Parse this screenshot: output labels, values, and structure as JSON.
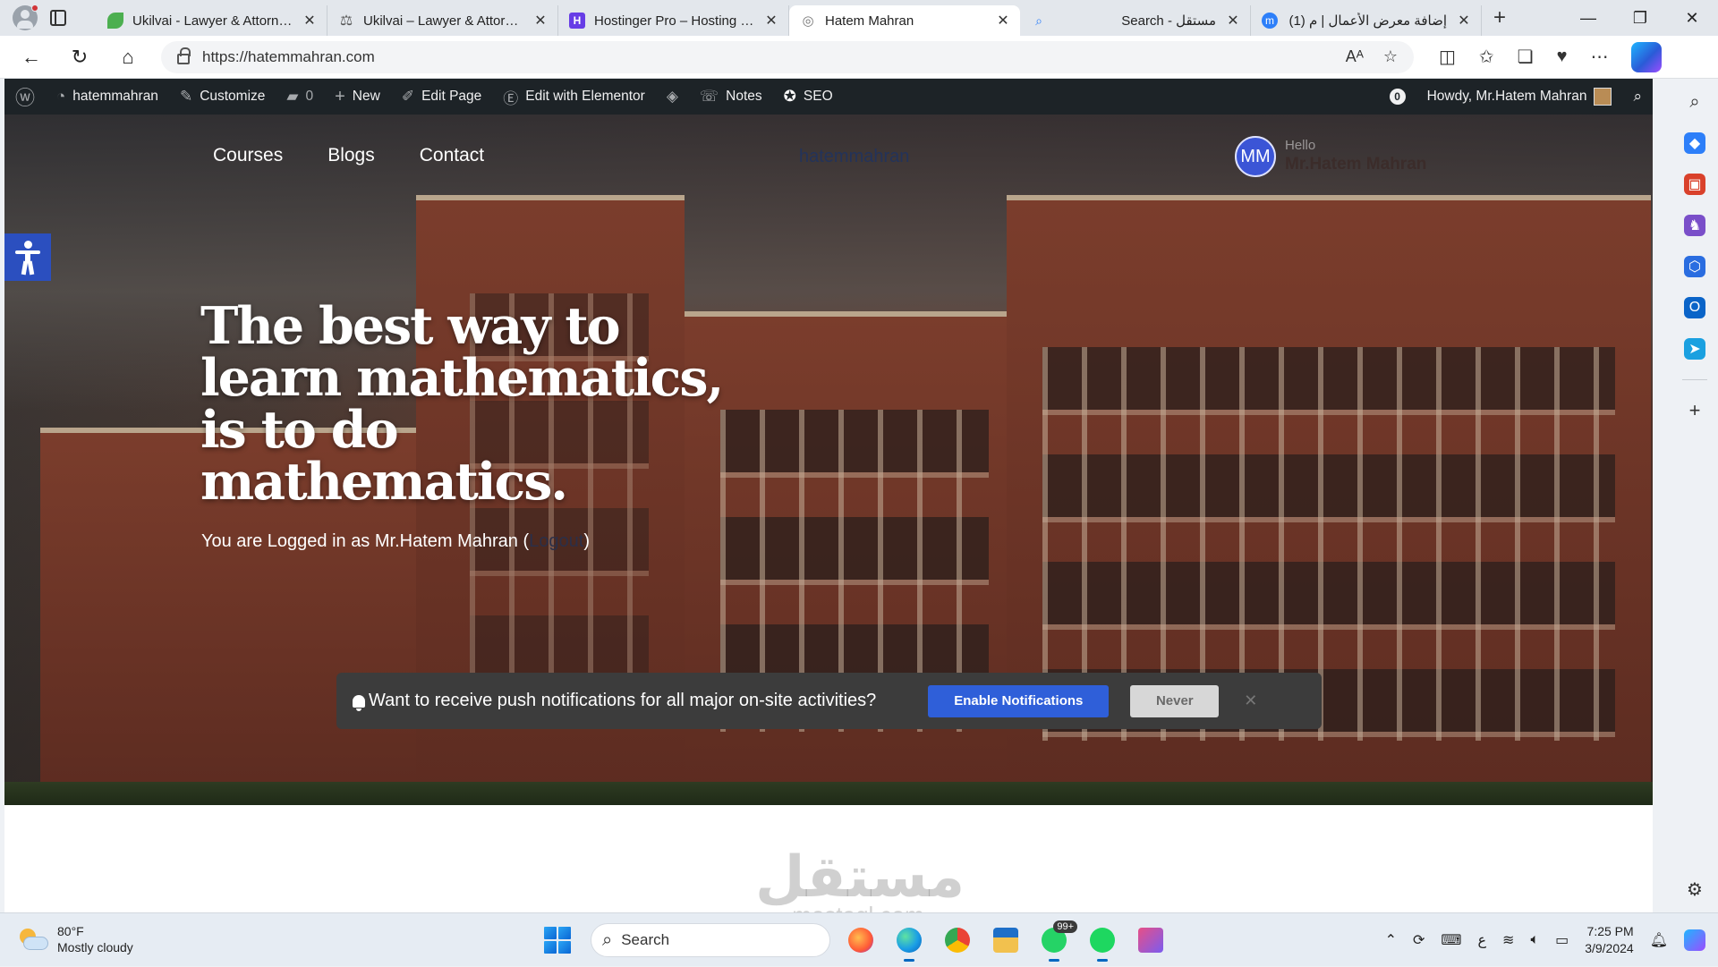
{
  "browser": {
    "tabs": [
      {
        "title": "Ukilvai - Lawyer & Attorney",
        "icon": "leaf-icon",
        "color": "#4caf50",
        "active": false
      },
      {
        "title": "Ukilvai – Lawyer & Attorney",
        "icon": "scales-icon",
        "color": "#555555",
        "active": false
      },
      {
        "title": "Hostinger Pro – Hosting for",
        "icon": "hostinger-icon",
        "color": "#673de6",
        "active": false
      },
      {
        "title": "Hatem Mahran",
        "icon": "globe-icon",
        "color": "#888888",
        "active": true
      },
      {
        "title": "Search - مستقل",
        "icon": "search-icon",
        "color": "#2d7ff9",
        "active": false
      },
      {
        "title": "(1) إضافة معرض الأعمال | م",
        "icon": "mostaql-icon",
        "color": "#2d7ff9",
        "active": false
      }
    ],
    "url": "https://hatemmahran.com",
    "win_controls": {
      "minimize": "—",
      "restore": "❐",
      "close": "✕"
    }
  },
  "wp_admin_bar": {
    "site_name": "hatemmahran",
    "customize": "Customize",
    "comments_count": "0",
    "new": "New",
    "edit_page": "Edit Page",
    "edit_elementor": "Edit with Elementor",
    "notes": "Notes",
    "seo": "SEO",
    "updates_count": "0",
    "howdy": "Howdy, Mr.Hatem Mahran"
  },
  "site": {
    "nav": [
      "Courses",
      "Blogs",
      "Contact"
    ],
    "brand": "hatemmahran",
    "user": {
      "initials": "MM",
      "hello": "Hello",
      "name": "Mr.Hatem Mahran"
    },
    "hero_title": "The best way to learn mathematics, is to do mathematics.",
    "login_prefix": "You are Logged in as Mr.Hatem Mahran (",
    "logout": "Logout",
    "login_suffix": ")"
  },
  "notification": {
    "text": "Want to receive push notifications for all major on-site activities?",
    "enable": "Enable Notifications",
    "never": "Never",
    "close": "✕"
  },
  "watermark": {
    "top": "مستقل",
    "bottom": "mostaql.com"
  },
  "taskbar": {
    "weather_temp": "80°F",
    "weather_desc": "Mostly cloudy",
    "search": "Search",
    "whatsapp_badge": "99+",
    "time": "7:25 PM",
    "date": "3/9/2024",
    "ime": "ع"
  },
  "colors": {
    "accent": "#2f5fd9",
    "admin_bar": "#1d2327",
    "a11y": "#2b4fbf"
  }
}
